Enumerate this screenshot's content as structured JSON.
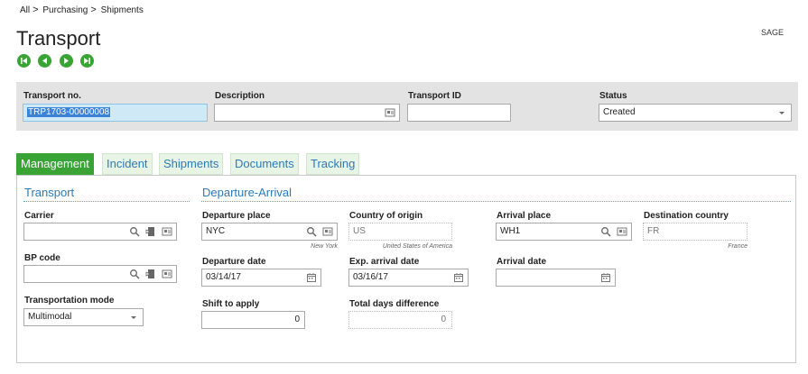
{
  "breadcrumb": [
    "All",
    "Purchasing",
    "Shipments"
  ],
  "breadcrumb_sep": ">",
  "page_title": "Transport",
  "sage_label": "SAGE",
  "header": {
    "transport_no_label": "Transport no.",
    "transport_no_value": "TRP1703-00000008",
    "description_label": "Description",
    "description_value": "",
    "transport_id_label": "Transport ID",
    "transport_id_value": "",
    "status_label": "Status",
    "status_value": "Created"
  },
  "tabs": [
    "Management",
    "Incident",
    "Shipments",
    "Documents",
    "Tracking"
  ],
  "transport_section": {
    "title": "Transport",
    "carrier_label": "Carrier",
    "carrier_value": "",
    "bp_code_label": "BP code",
    "bp_code_value": "",
    "transport_mode_label": "Transportation mode",
    "transport_mode_value": "Multimodal"
  },
  "departure_section": {
    "title": "Departure-Arrival",
    "departure_place_label": "Departure place",
    "departure_place_value": "NYC",
    "departure_place_sub": "New York",
    "country_origin_label": "Country of origin",
    "country_origin_value": "US",
    "country_origin_sub": "United States of America",
    "arrival_place_label": "Arrival place",
    "arrival_place_value": "WH1",
    "destination_country_label": "Destination country",
    "destination_country_value": "FR",
    "destination_country_sub": "France",
    "departure_date_label": "Departure date",
    "departure_date_value": "03/14/17",
    "exp_arrival_date_label": "Exp. arrival date",
    "exp_arrival_date_value": "03/16/17",
    "arrival_date_label": "Arrival date",
    "arrival_date_value": "",
    "shift_label": "Shift to apply",
    "shift_value": "0",
    "total_days_label": "Total days difference",
    "total_days_value": "0"
  },
  "colors": {
    "accent_green": "#3aa335",
    "link_blue": "#2d7ab8",
    "header_gray": "#e3e3e3"
  },
  "icons": [
    "first-record-icon",
    "previous-record-icon",
    "next-record-icon",
    "last-record-icon",
    "search-icon",
    "tunnel-icon",
    "selection-icon",
    "calendar-icon",
    "dropdown-arrow-icon"
  ]
}
